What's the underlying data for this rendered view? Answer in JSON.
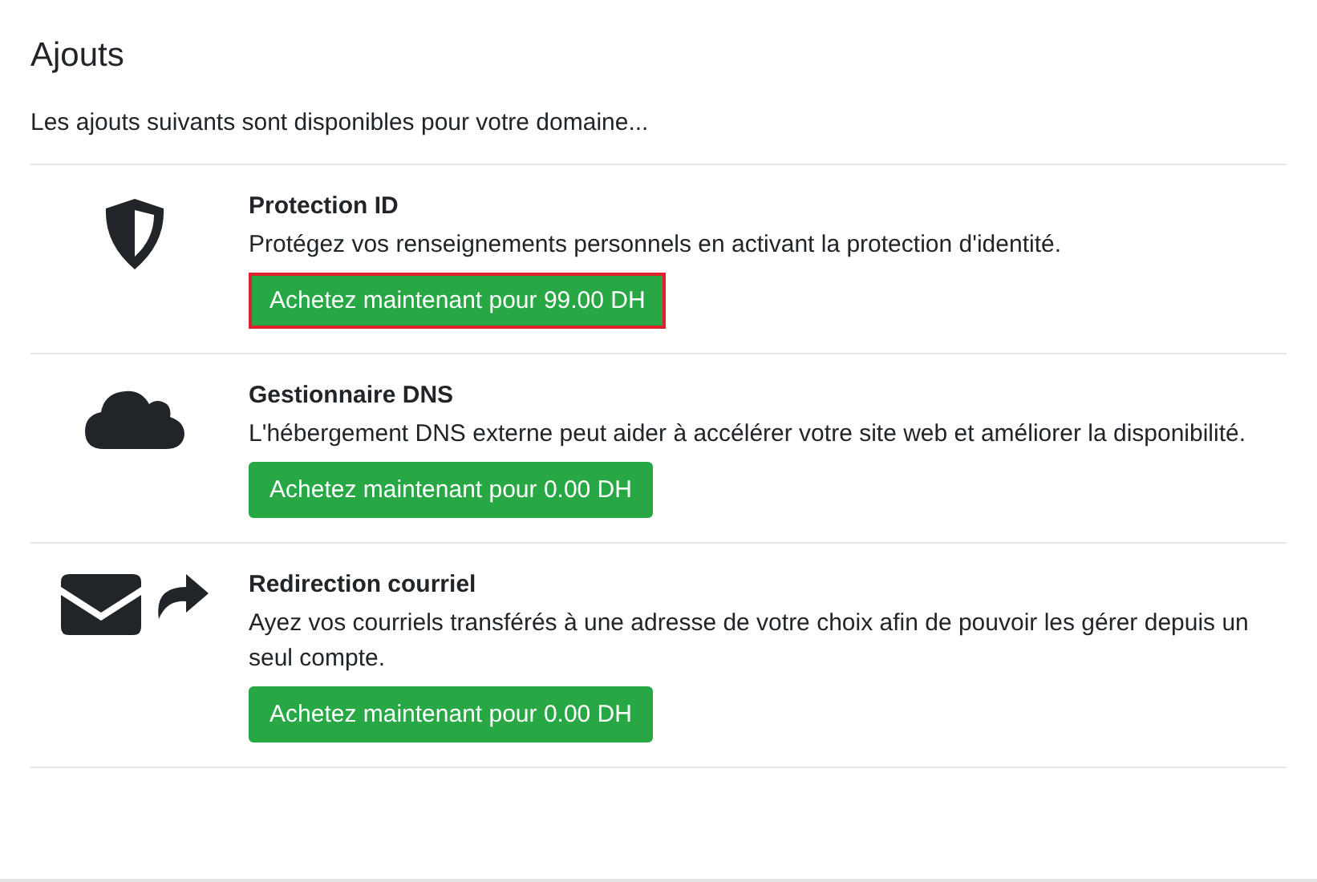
{
  "title": "Ajouts",
  "intro": "Les ajouts suivants sont disponibles pour votre domaine...",
  "addons": [
    {
      "kind": "shield",
      "name": "Protection ID",
      "description": "Protégez vos renseignements personnels en activant la protection d'identité.",
      "button": "Achetez maintenant pour 99.00 DH",
      "highlighted": true
    },
    {
      "kind": "cloud",
      "name": "Gestionnaire DNS",
      "description": "L'hébergement DNS externe peut aider à accélérer votre site web et améliorer la disponibilité.",
      "button": "Achetez maintenant pour 0.00 DH",
      "highlighted": false
    },
    {
      "kind": "mail-forward",
      "name": "Redirection courriel",
      "description": "Ayez vos courriels transférés à une adresse de votre choix afin de pouvoir les gérer depuis un seul compte.",
      "button": "Achetez maintenant pour 0.00 DH",
      "highlighted": false
    }
  ]
}
